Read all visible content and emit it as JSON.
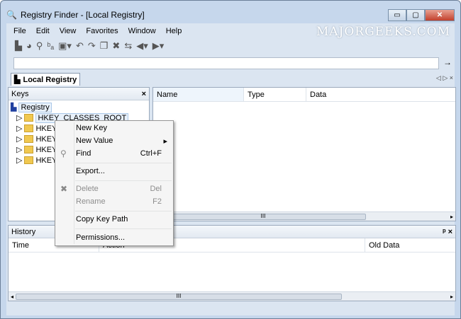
{
  "window": {
    "title": "Registry Finder - [Local Registry]",
    "minimize": "▭",
    "maximize": "▢",
    "close": "✕"
  },
  "menu": [
    "File",
    "Edit",
    "View",
    "Favorites",
    "Window",
    "Help"
  ],
  "watermark": "MAJORGEEKS.COM",
  "toolbar_icons": [
    "local-registry-icon",
    "remote-registry-icon",
    "find-icon",
    "replace-icon",
    "save-icon",
    "undo-icon",
    "redo-icon",
    "copy-icon",
    "delete-icon",
    "refresh-icon",
    "back-icon",
    "forward-icon"
  ],
  "address": {
    "value": "",
    "go": "→"
  },
  "tab": {
    "label": "Local Registry",
    "nav": "◁ ▷ ×"
  },
  "keys_pane": {
    "title": "Keys",
    "close": "×",
    "root": "Registry",
    "items": [
      "HKEY_CLASSES_ROOT",
      "HKEY_",
      "HKEY_",
      "HKEY_",
      "HKEY_"
    ]
  },
  "values_pane": {
    "columns": [
      "Name",
      "Type",
      "Data"
    ]
  },
  "history_pane": {
    "title": "History",
    "pin": "ᵖ",
    "close": "×",
    "columns": [
      "Time",
      "Action",
      "Old Data"
    ]
  },
  "context_menu": {
    "new_key": "New Key",
    "new_value": "New Value",
    "find": "Find",
    "find_sc": "Ctrl+F",
    "export": "Export...",
    "delete": "Delete",
    "delete_sc": "Del",
    "rename": "Rename",
    "rename_sc": "F2",
    "copy_path": "Copy Key Path",
    "permissions": "Permissions..."
  },
  "scroll_grip": "III"
}
